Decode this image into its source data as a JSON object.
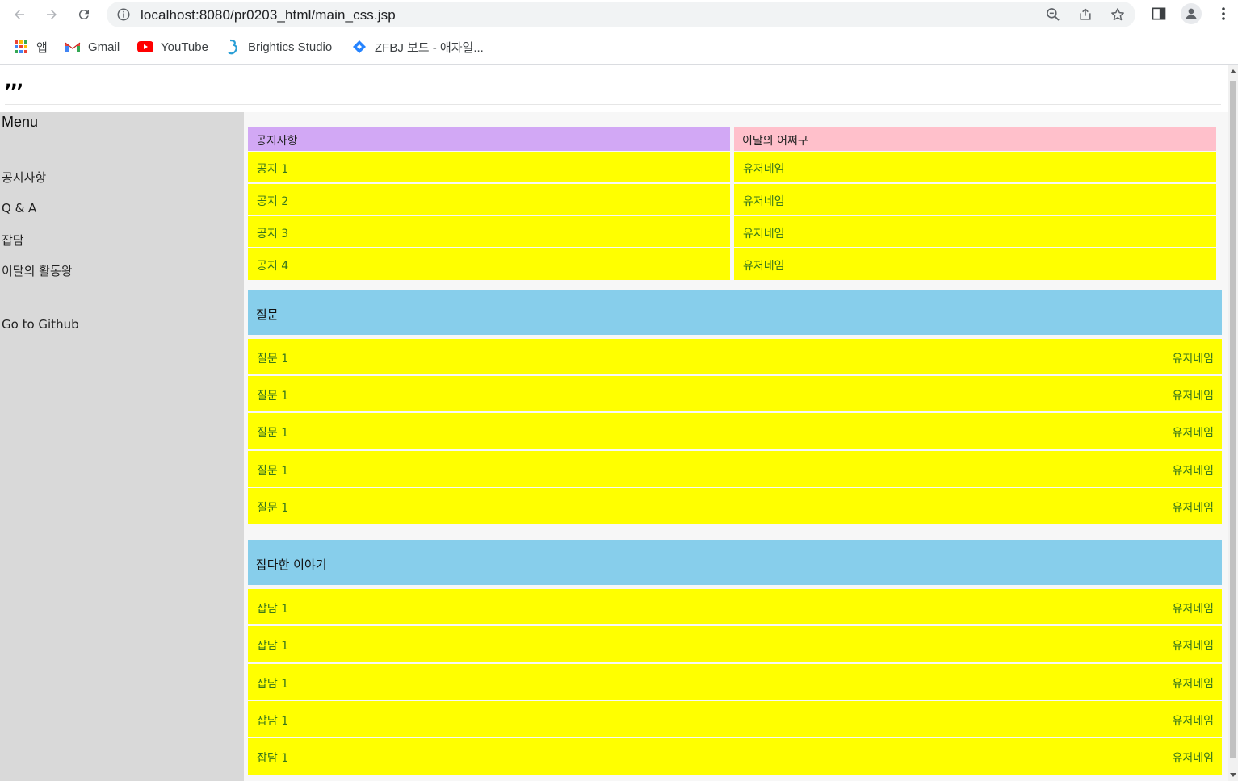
{
  "browser": {
    "url": "localhost:8080/pr0203_html/main_css.jsp",
    "bookmarks": [
      {
        "label": "앱",
        "icon": "apps-grid-icon"
      },
      {
        "label": "Gmail",
        "icon": "gmail-icon"
      },
      {
        "label": "YouTube",
        "icon": "youtube-icon"
      },
      {
        "label": "Brightics Studio",
        "icon": "brightics-icon"
      },
      {
        "label": "ZFBJ 보드 - 애자일...",
        "icon": "jira-diamond-icon"
      }
    ]
  },
  "site": {
    "logo": ",,,"
  },
  "sidebar": {
    "title": "Menu",
    "items": [
      "공지사항",
      "Q & A",
      "잡담",
      "이달의 활동왕"
    ],
    "github": "Go to Github"
  },
  "notice": {
    "title": "공지사항",
    "rows": [
      "공지 1",
      "공지 2",
      "공지 3",
      "공지 4"
    ]
  },
  "monthly": {
    "title": "이달의 어쩌구",
    "rows": [
      "유저네임",
      "유저네임",
      "유저네임",
      "유저네임"
    ]
  },
  "qna": {
    "title": "질문",
    "rows": [
      {
        "title": "질문 1",
        "user": "유저네임"
      },
      {
        "title": "질문 1",
        "user": "유저네임"
      },
      {
        "title": "질문 1",
        "user": "유저네임"
      },
      {
        "title": "질문 1",
        "user": "유저네임"
      },
      {
        "title": "질문 1",
        "user": "유저네임"
      }
    ]
  },
  "chat": {
    "title": "잡다한 이야기",
    "rows": [
      {
        "title": "잡담 1",
        "user": "유저네임"
      },
      {
        "title": "잡담 1",
        "user": "유저네임"
      },
      {
        "title": "잡담 1",
        "user": "유저네임"
      },
      {
        "title": "잡담 1",
        "user": "유저네임"
      },
      {
        "title": "잡담 1",
        "user": "유저네임"
      }
    ]
  },
  "colors": {
    "row_bg": "#ffff00",
    "row_text": "#38761d",
    "notice_header": "#d2a8f5",
    "monthly_header": "#ffc0cb",
    "section_header": "#87ceeb",
    "sidebar_bg": "#d9d9d9"
  }
}
